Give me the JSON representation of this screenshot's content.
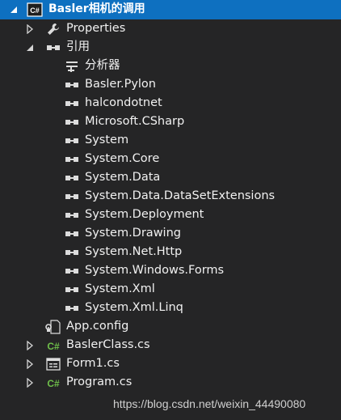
{
  "solution_explorer": {
    "project": {
      "label": "Basler相机的调用",
      "icon": "csharp-project-icon",
      "expanded": true
    },
    "items": [
      {
        "label": "Properties",
        "icon": "wrench-icon",
        "expanded": false
      },
      {
        "label": "引用",
        "icon": "reference-icon",
        "expanded": true
      },
      {
        "label": "分析器",
        "icon": "analyzer-icon"
      },
      {
        "label": "Basler.Pylon",
        "icon": "reference-icon"
      },
      {
        "label": "halcondotnet",
        "icon": "reference-icon"
      },
      {
        "label": "Microsoft.CSharp",
        "icon": "reference-icon"
      },
      {
        "label": "System",
        "icon": "reference-icon"
      },
      {
        "label": "System.Core",
        "icon": "reference-icon"
      },
      {
        "label": "System.Data",
        "icon": "reference-icon"
      },
      {
        "label": "System.Data.DataSetExtensions",
        "icon": "reference-icon"
      },
      {
        "label": "System.Deployment",
        "icon": "reference-icon"
      },
      {
        "label": "System.Drawing",
        "icon": "reference-icon"
      },
      {
        "label": "System.Net.Http",
        "icon": "reference-icon"
      },
      {
        "label": "System.Windows.Forms",
        "icon": "reference-icon"
      },
      {
        "label": "System.Xml",
        "icon": "reference-icon"
      },
      {
        "label": "System.Xml.Linq",
        "icon": "reference-icon"
      },
      {
        "label": "App.config",
        "icon": "config-file-icon"
      },
      {
        "label": "BaslerClass.cs",
        "icon": "csharp-file-icon",
        "expanded": false
      },
      {
        "label": "Form1.cs",
        "icon": "form-icon",
        "expanded": false
      },
      {
        "label": "Program.cs",
        "icon": "csharp-file-icon",
        "expanded": false
      }
    ]
  },
  "watermark": "https://blog.csdn.net/weixin_44490080",
  "colors": {
    "background": "#252526",
    "selection": "#0e70c0",
    "text": "#f1f1f1",
    "csharp_green": "#6fbf4a"
  }
}
